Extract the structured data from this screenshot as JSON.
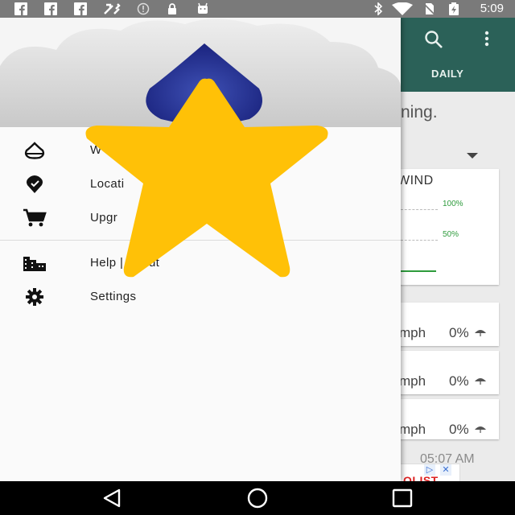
{
  "status_bar": {
    "time": "5:09",
    "icons": [
      "facebook-icon",
      "facebook-icon",
      "facebook-icon",
      "tools-icon",
      "alert-icon",
      "lock-icon",
      "android-icon",
      "bluetooth-icon",
      "wifi-icon",
      "no-sim-icon",
      "battery-charging-icon"
    ]
  },
  "app": {
    "toolbar": {
      "icons": [
        "search-icon",
        "more-vert-icon"
      ]
    },
    "tabs": [
      {
        "label": "DAILY"
      }
    ],
    "partial_text": "ning.",
    "wind_card": {
      "title": "WIND",
      "pct_high": "100%",
      "pct_mid": "50%"
    },
    "rows": [
      {
        "speed": "mph",
        "precip": "0%"
      },
      {
        "speed": "mph",
        "precip": "0%"
      },
      {
        "speed": "mph",
        "precip": "0%"
      }
    ],
    "clock": "05:07 AM",
    "ad": {
      "text": "OLIST"
    }
  },
  "drawer": {
    "items": [
      {
        "label": "W",
        "icon": "droplet-outline-icon"
      },
      {
        "label": "Locati",
        "icon": "location-pin-icon"
      },
      {
        "label": "Upgr",
        "icon": "shopping-cart-icon"
      },
      {
        "label": "Help | About",
        "icon": "city-icon"
      },
      {
        "label": "Settings",
        "icon": "settings-icon"
      }
    ]
  },
  "overlay": {
    "icon": "star-icon",
    "color": "#FFC107"
  },
  "colors": {
    "app_bar": "#2B6158",
    "drawer_header_drop": "#283593",
    "chart_green": "#2E9B3C"
  },
  "nav_bar": {
    "icons": [
      "back-icon",
      "home-icon",
      "recents-icon"
    ]
  }
}
